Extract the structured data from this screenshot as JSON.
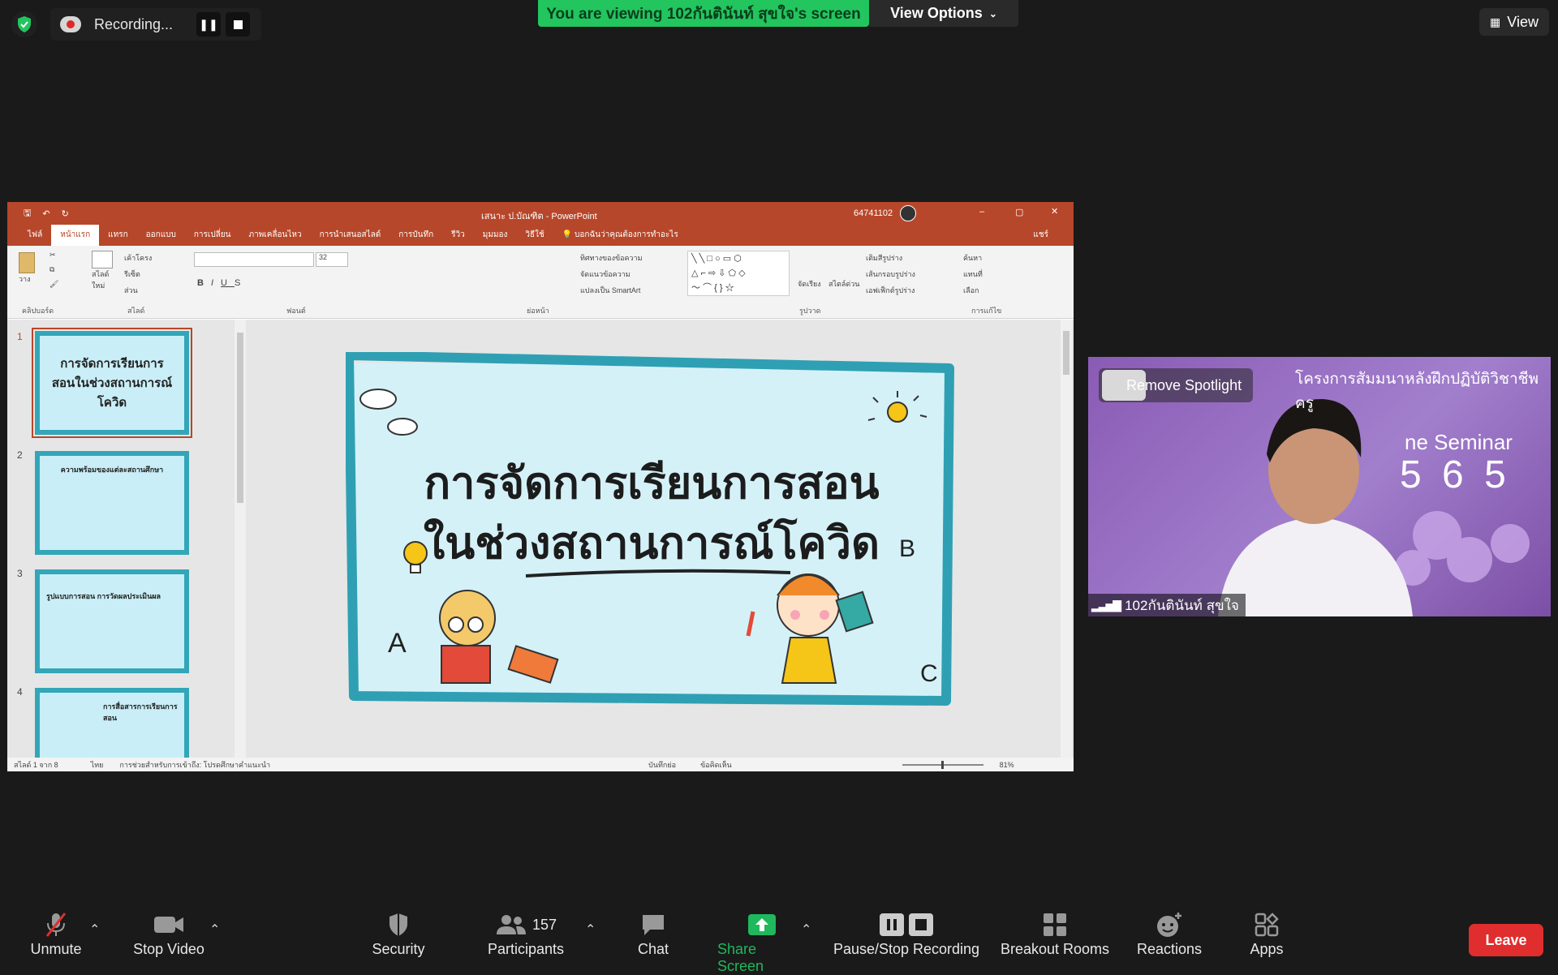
{
  "topbar": {
    "recording_label": "Recording...",
    "viewing_banner": "You are viewing 102กันตินันท์ สุขใจ's screen",
    "view_options": "View Options",
    "view_button": "View"
  },
  "powerpoint": {
    "doc_title": "เสนาะ ป.บัณฑิต  -  PowerPoint",
    "user_id": "64741102",
    "tabs": [
      "ไฟล์",
      "หน้าแรก",
      "แทรก",
      "ออกแบบ",
      "การเปลี่ยน",
      "ภาพเคลื่อนไหว",
      "การนำเสนอสไลด์",
      "การบันทึก",
      "รีวิว",
      "มุมมอง",
      "วิธีใช้",
      "บอกฉันว่าคุณต้องการทำอะไร"
    ],
    "share": "แชร์",
    "ribbon_groups": [
      "คลิปบอร์ด",
      "สไลด์",
      "ฟอนต์",
      "ย่อหน้า",
      "รูปวาด",
      "การแก้ไข"
    ],
    "ribbon_items": {
      "paste": "วาง",
      "new_slide": "สไลด์ใหม่",
      "layout": "เค้าโครง",
      "reset": "รีเซ็ต",
      "section": "ส่วน",
      "font_size": "32",
      "text_direction": "ทิศทางของข้อความ",
      "align_text": "จัดแนวข้อความ",
      "smartart": "แปลงเป็น SmartArt",
      "arrange": "จัดเรียง",
      "quick_styles": "สไตล์ด่วน",
      "shape_fill": "เติมสีรูปร่าง",
      "shape_outline": "เส้นกรอบรูปร่าง",
      "shape_effects": "เอฟเฟ็กต์รูปร่าง",
      "find": "ค้นหา",
      "replace": "แทนที่",
      "select": "เลือก"
    },
    "thumbnails": [
      {
        "num": "1",
        "title": "การจัดการเรียนการสอนในช่วงสถานการณ์โควิด"
      },
      {
        "num": "2",
        "title": "ความพร้อมของแต่ละสถานศึกษา"
      },
      {
        "num": "3",
        "title": "รูปแบบการสอน การวัดผลประเมินผล"
      },
      {
        "num": "4",
        "title": "การสื่อสารการเรียนการสอน"
      }
    ],
    "slide": {
      "line1": "การจัดการเรียนการสอน",
      "line2": "ในช่วงสถานการณ์โควิด",
      "letters": [
        "A",
        "B",
        "C"
      ]
    },
    "status": {
      "slide_count": "สไลด์ 1 จาก 8",
      "language": "ไทย",
      "accessibility": "การช่วยสำหรับการเข้าถึง: โปรดศึกษาคำแนะนำ",
      "notes": "บันทึกย่อ",
      "comments": "ข้อคิดเห็น",
      "zoom": "81%"
    }
  },
  "video": {
    "remove_spotlight": "Remove Spotlight",
    "participant_name": "102กันตินันท์ สุขใจ",
    "banner_line1": "โครงการสัมมนาหลังฝึกปฏิบัติวิชาชีพครู",
    "banner_line2": "ne Seminar",
    "banner_line3": "5 6 5"
  },
  "toolbar": {
    "unmute": "Unmute",
    "stop_video": "Stop Video",
    "security": "Security",
    "participants": "Participants",
    "participants_count": "157",
    "chat": "Chat",
    "share_screen": "Share Screen",
    "pause_recording": "Pause/Stop Recording",
    "breakout_rooms": "Breakout Rooms",
    "reactions": "Reactions",
    "apps": "Apps",
    "leave": "Leave"
  },
  "colors": {
    "banner_green": "#22c55e",
    "ppt_orange": "#b7472a",
    "slide_border": "#33a6b8",
    "leave_red": "#e02d2d",
    "share_green": "#1fb85c"
  }
}
